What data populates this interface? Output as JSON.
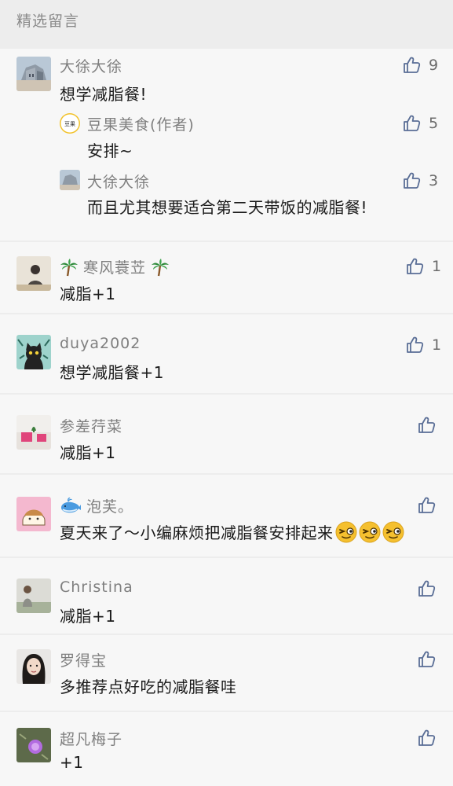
{
  "section_title": "精选留言",
  "comments": [
    {
      "nick": "大徐大徐",
      "text": "想学减脂餐!",
      "likes": "9",
      "replies": [
        {
          "nick": "豆果美食(作者)",
          "text": "安排~",
          "likes": "5",
          "avatar_label": "豆果"
        },
        {
          "nick": "大徐大徐",
          "text": "而且尤其想要适合第二天带饭的减脂餐!",
          "likes": "3"
        }
      ]
    },
    {
      "nick": "寒风蓑苙",
      "nick_prefix_icon": "palm-tree-icon",
      "nick_suffix_icon": "palm-tree-icon",
      "text": "减脂+1",
      "likes": "1"
    },
    {
      "nick": "duya2002",
      "text": "想学减脂餐+1",
      "likes": "1"
    },
    {
      "nick": "参差荇菜",
      "text": "减脂+1",
      "likes": ""
    },
    {
      "nick": "泡芙。",
      "nick_prefix_icon": "whale-icon",
      "text": "夏天来了～小编麻烦把减脂餐安排起来",
      "text_suffix_icons": [
        "squinting-face-emoji",
        "squinting-face-emoji",
        "squinting-face-emoji"
      ],
      "likes": ""
    },
    {
      "nick": "Christina",
      "text": "减脂+1",
      "likes": ""
    },
    {
      "nick": "罗得宝",
      "text": "多推荐点好吃的减脂餐哇",
      "likes": ""
    },
    {
      "nick": "超凡梅子",
      "text": "+1",
      "likes": ""
    }
  ]
}
